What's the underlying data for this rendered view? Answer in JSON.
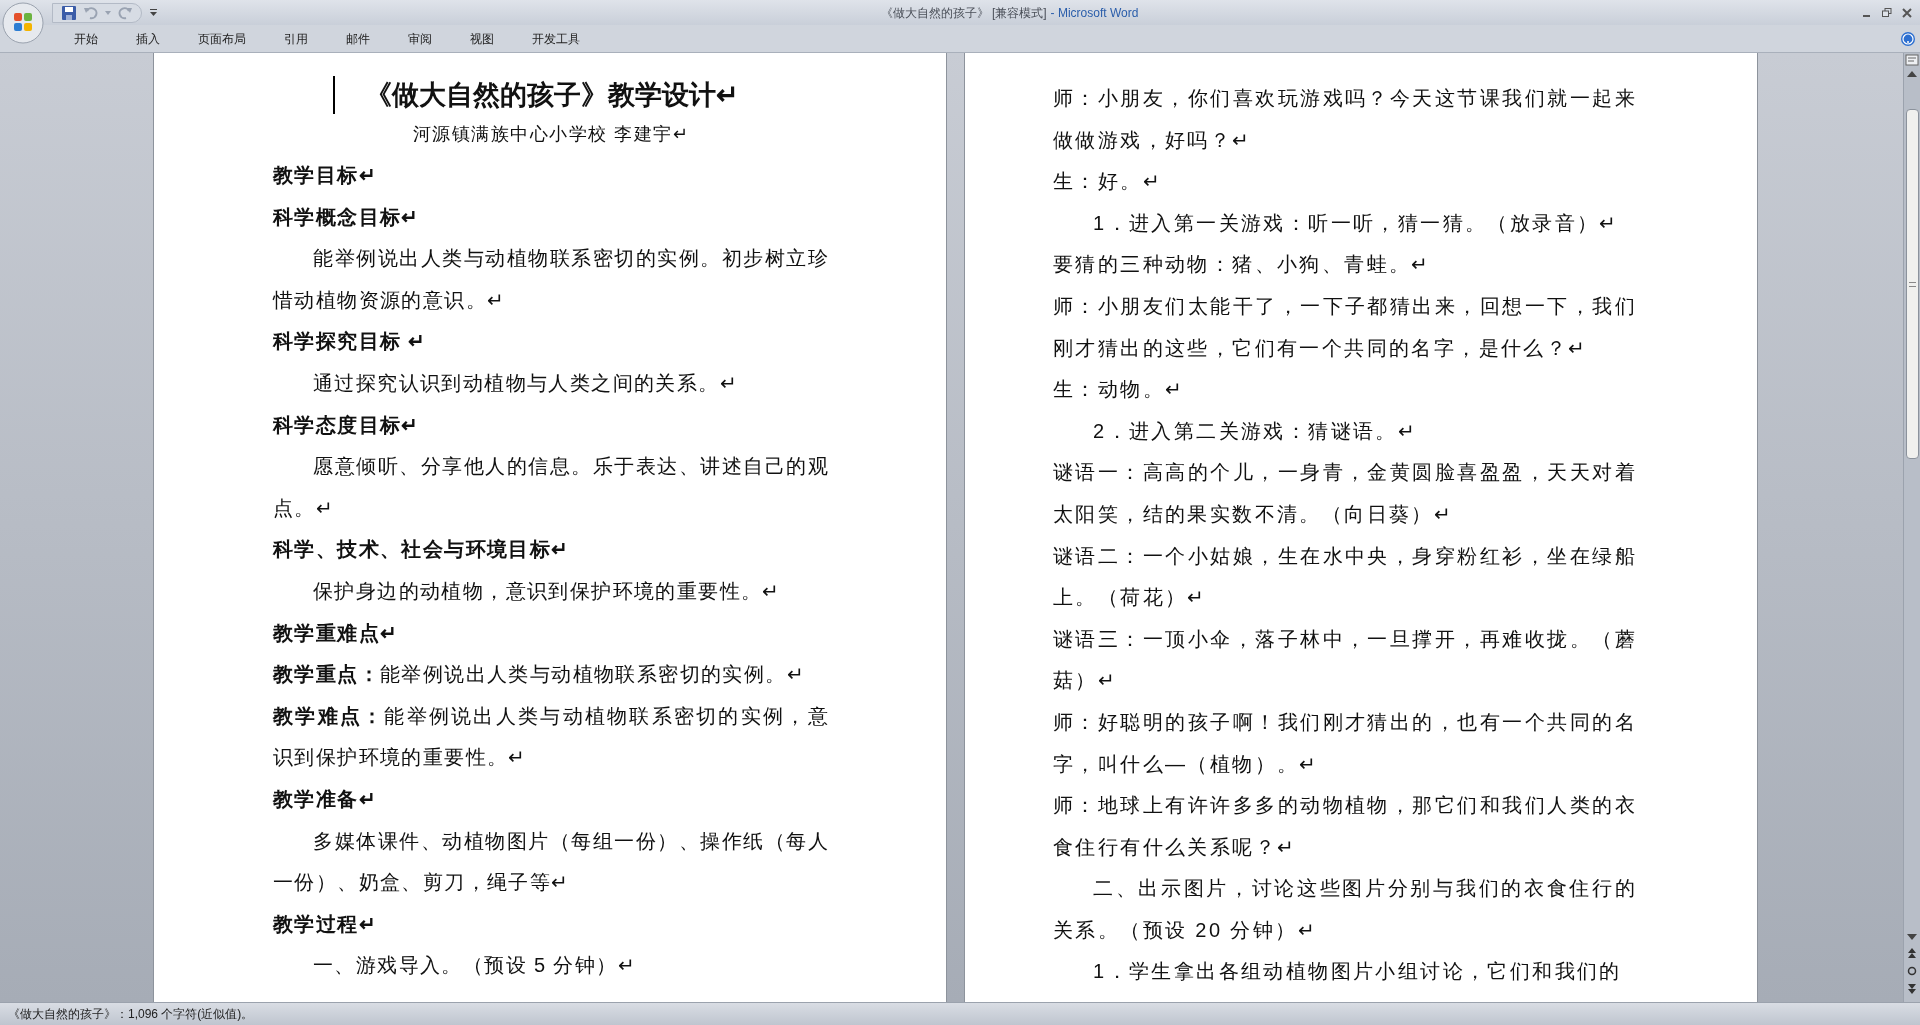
{
  "window": {
    "document_title": "《做大自然的孩子》 [兼容模式]",
    "app_title": "- Microsoft Word"
  },
  "ribbon_tabs": [
    {
      "label": "开始"
    },
    {
      "label": "插入"
    },
    {
      "label": "页面布局"
    },
    {
      "label": "引用"
    },
    {
      "label": "邮件"
    },
    {
      "label": "审阅"
    },
    {
      "label": "视图"
    },
    {
      "label": "开发工具"
    }
  ],
  "pages": [
    {
      "paragraphs": [
        {
          "kind": "title",
          "text": "《做大自然的孩子》教学设计↵"
        },
        {
          "kind": "subtitle",
          "text": "河源镇满族中心小学校 李建宇↵"
        },
        {
          "kind": "heading",
          "text": "教学目标↵"
        },
        {
          "kind": "heading",
          "text": "科学概念目标↵"
        },
        {
          "kind": "body",
          "text": "能举例说出人类与动植物联系密切的实例。初步树立珍惜动植物资源的意识。↵"
        },
        {
          "kind": "heading",
          "text": "科学探究目标 ↵"
        },
        {
          "kind": "body",
          "text": "通过探究认识到动植物与人类之间的关系。↵"
        },
        {
          "kind": "heading",
          "text": "科学态度目标↵"
        },
        {
          "kind": "body",
          "text": "愿意倾听、分享他人的信息。乐于表达、讲述自己的观点。↵"
        },
        {
          "kind": "heading",
          "text": "科学、技术、社会与环境目标↵"
        },
        {
          "kind": "body",
          "text": "保护身边的动植物，意识到保护环境的重要性。↵"
        },
        {
          "kind": "heading",
          "text": "教学重难点↵"
        },
        {
          "kind": "plain",
          "text": "**教学重点：**能举例说出人类与动植物联系密切的实例。↵"
        },
        {
          "kind": "plain",
          "text": "**教学难点：**能举例说出人类与动植物联系密切的实例，意识到保护环境的重要性。↵"
        },
        {
          "kind": "heading",
          "text": "教学准备↵"
        },
        {
          "kind": "body",
          "text": "多媒体课件、动植物图片（每组一份）、操作纸（每人一份）、奶盒、剪刀，绳子等↵"
        },
        {
          "kind": "heading",
          "text": "教学过程↵"
        },
        {
          "kind": "body",
          "text": "一、游戏导入。（预设 5 分钟）↵"
        }
      ]
    },
    {
      "paragraphs": [
        {
          "kind": "plain",
          "text": "师：小朋友，你们喜欢玩游戏吗？今天这节课我们就一起来做做游戏，好吗？↵"
        },
        {
          "kind": "plain",
          "text": "生：好。↵"
        },
        {
          "kind": "body",
          "text": "1．进入第一关游戏：听一听，猜一猜。（放录音）↵"
        },
        {
          "kind": "plain",
          "text": "要猜的三种动物：猪、小狗、青蛙。↵"
        },
        {
          "kind": "plain",
          "text": "师：小朋友们太能干了，一下子都猜出来，回想一下，我们刚才猜出的这些，它们有一个共同的名字，是什么？↵"
        },
        {
          "kind": "plain",
          "text": "生：动物。↵"
        },
        {
          "kind": "body",
          "text": "2．进入第二关游戏：猜谜语。↵"
        },
        {
          "kind": "plain",
          "text": "谜语一：高高的个儿，一身青，金黄圆脸喜盈盈，天天对着太阳笑，结的果实数不清。（向日葵）↵"
        },
        {
          "kind": "plain",
          "text": "谜语二：一个小姑娘，生在水中央，身穿粉红衫，坐在绿船上。（荷花）↵"
        },
        {
          "kind": "plain",
          "text": "谜语三：一顶小伞，落子林中，一旦撑开，再难收拢。（蘑菇）↵"
        },
        {
          "kind": "plain",
          "text": "师：好聪明的孩子啊！我们刚才猜出的，也有一个共同的名字，叫什么—（植物）。↵"
        },
        {
          "kind": "plain",
          "text": "师：地球上有许许多多的动物植物，那它们和我们人类的衣食住行有什么关系呢？↵"
        },
        {
          "kind": "body",
          "text": "二、出示图片，讨论这些图片分别与我们的衣食住行的关系。（预设 20 分钟）↵"
        },
        {
          "kind": "body",
          "text": "1．学生拿出各组动植物图片小组讨论，它们和我们的"
        }
      ]
    }
  ],
  "status_bar": {
    "text": "《做大自然的孩子》：1,096 个字符(近似值)。"
  }
}
